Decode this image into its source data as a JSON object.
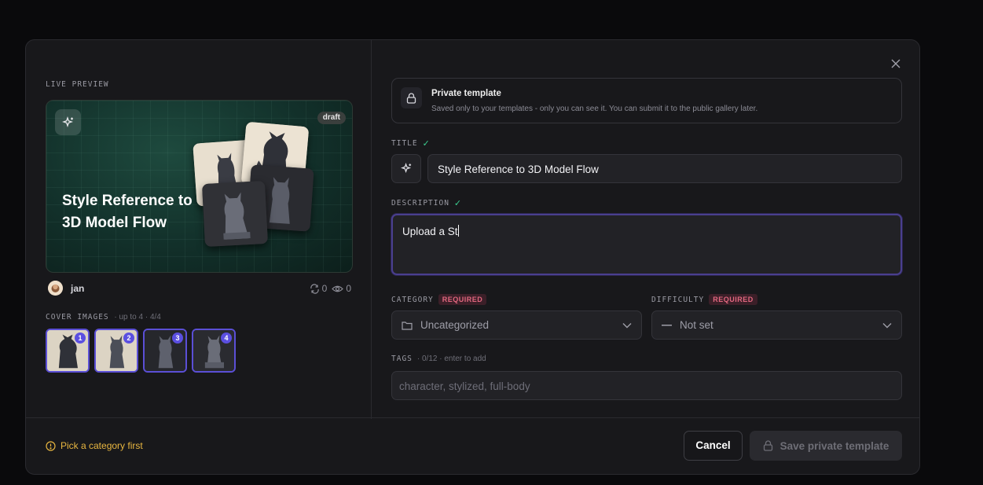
{
  "preview": {
    "section_label": "LIVE PREVIEW",
    "badge": "draft",
    "title": "Style Reference to 3D Model Flow",
    "author": "jan",
    "remix_count": "0",
    "view_count": "0"
  },
  "cover_images": {
    "label": "COVER IMAGES",
    "sub": "· up to 4 · 4/4",
    "items": [
      {
        "index": "1",
        "subject": "owl"
      },
      {
        "index": "2",
        "subject": "cat"
      },
      {
        "index": "3",
        "subject": "cat"
      },
      {
        "index": "4",
        "subject": "cat"
      }
    ]
  },
  "private": {
    "title": "Private template",
    "description": "Saved only to your templates - only you can see it. You can submit it to the public gallery later."
  },
  "fields": {
    "title_label": "TITLE",
    "title_value": "Style Reference to 3D Model Flow",
    "description_label": "DESCRIPTION",
    "description_value": "Upload a St",
    "category_label": "CATEGORY",
    "category_required": "REQUIRED",
    "category_value": "Uncategorized",
    "difficulty_label": "DIFFICULTY",
    "difficulty_required": "REQUIRED",
    "difficulty_value": "Not set",
    "tags_label": "TAGS",
    "tags_sub": "· 0/12 · enter to add",
    "tags_placeholder": "character, stylized, full-body"
  },
  "footer": {
    "warning": "Pick a category first",
    "cancel": "Cancel",
    "save": "Save private template"
  },
  "colors": {
    "accent": "#5b4fe0",
    "warning": "#e8b640",
    "required": "#e2677f",
    "check": "#3ccf91"
  }
}
